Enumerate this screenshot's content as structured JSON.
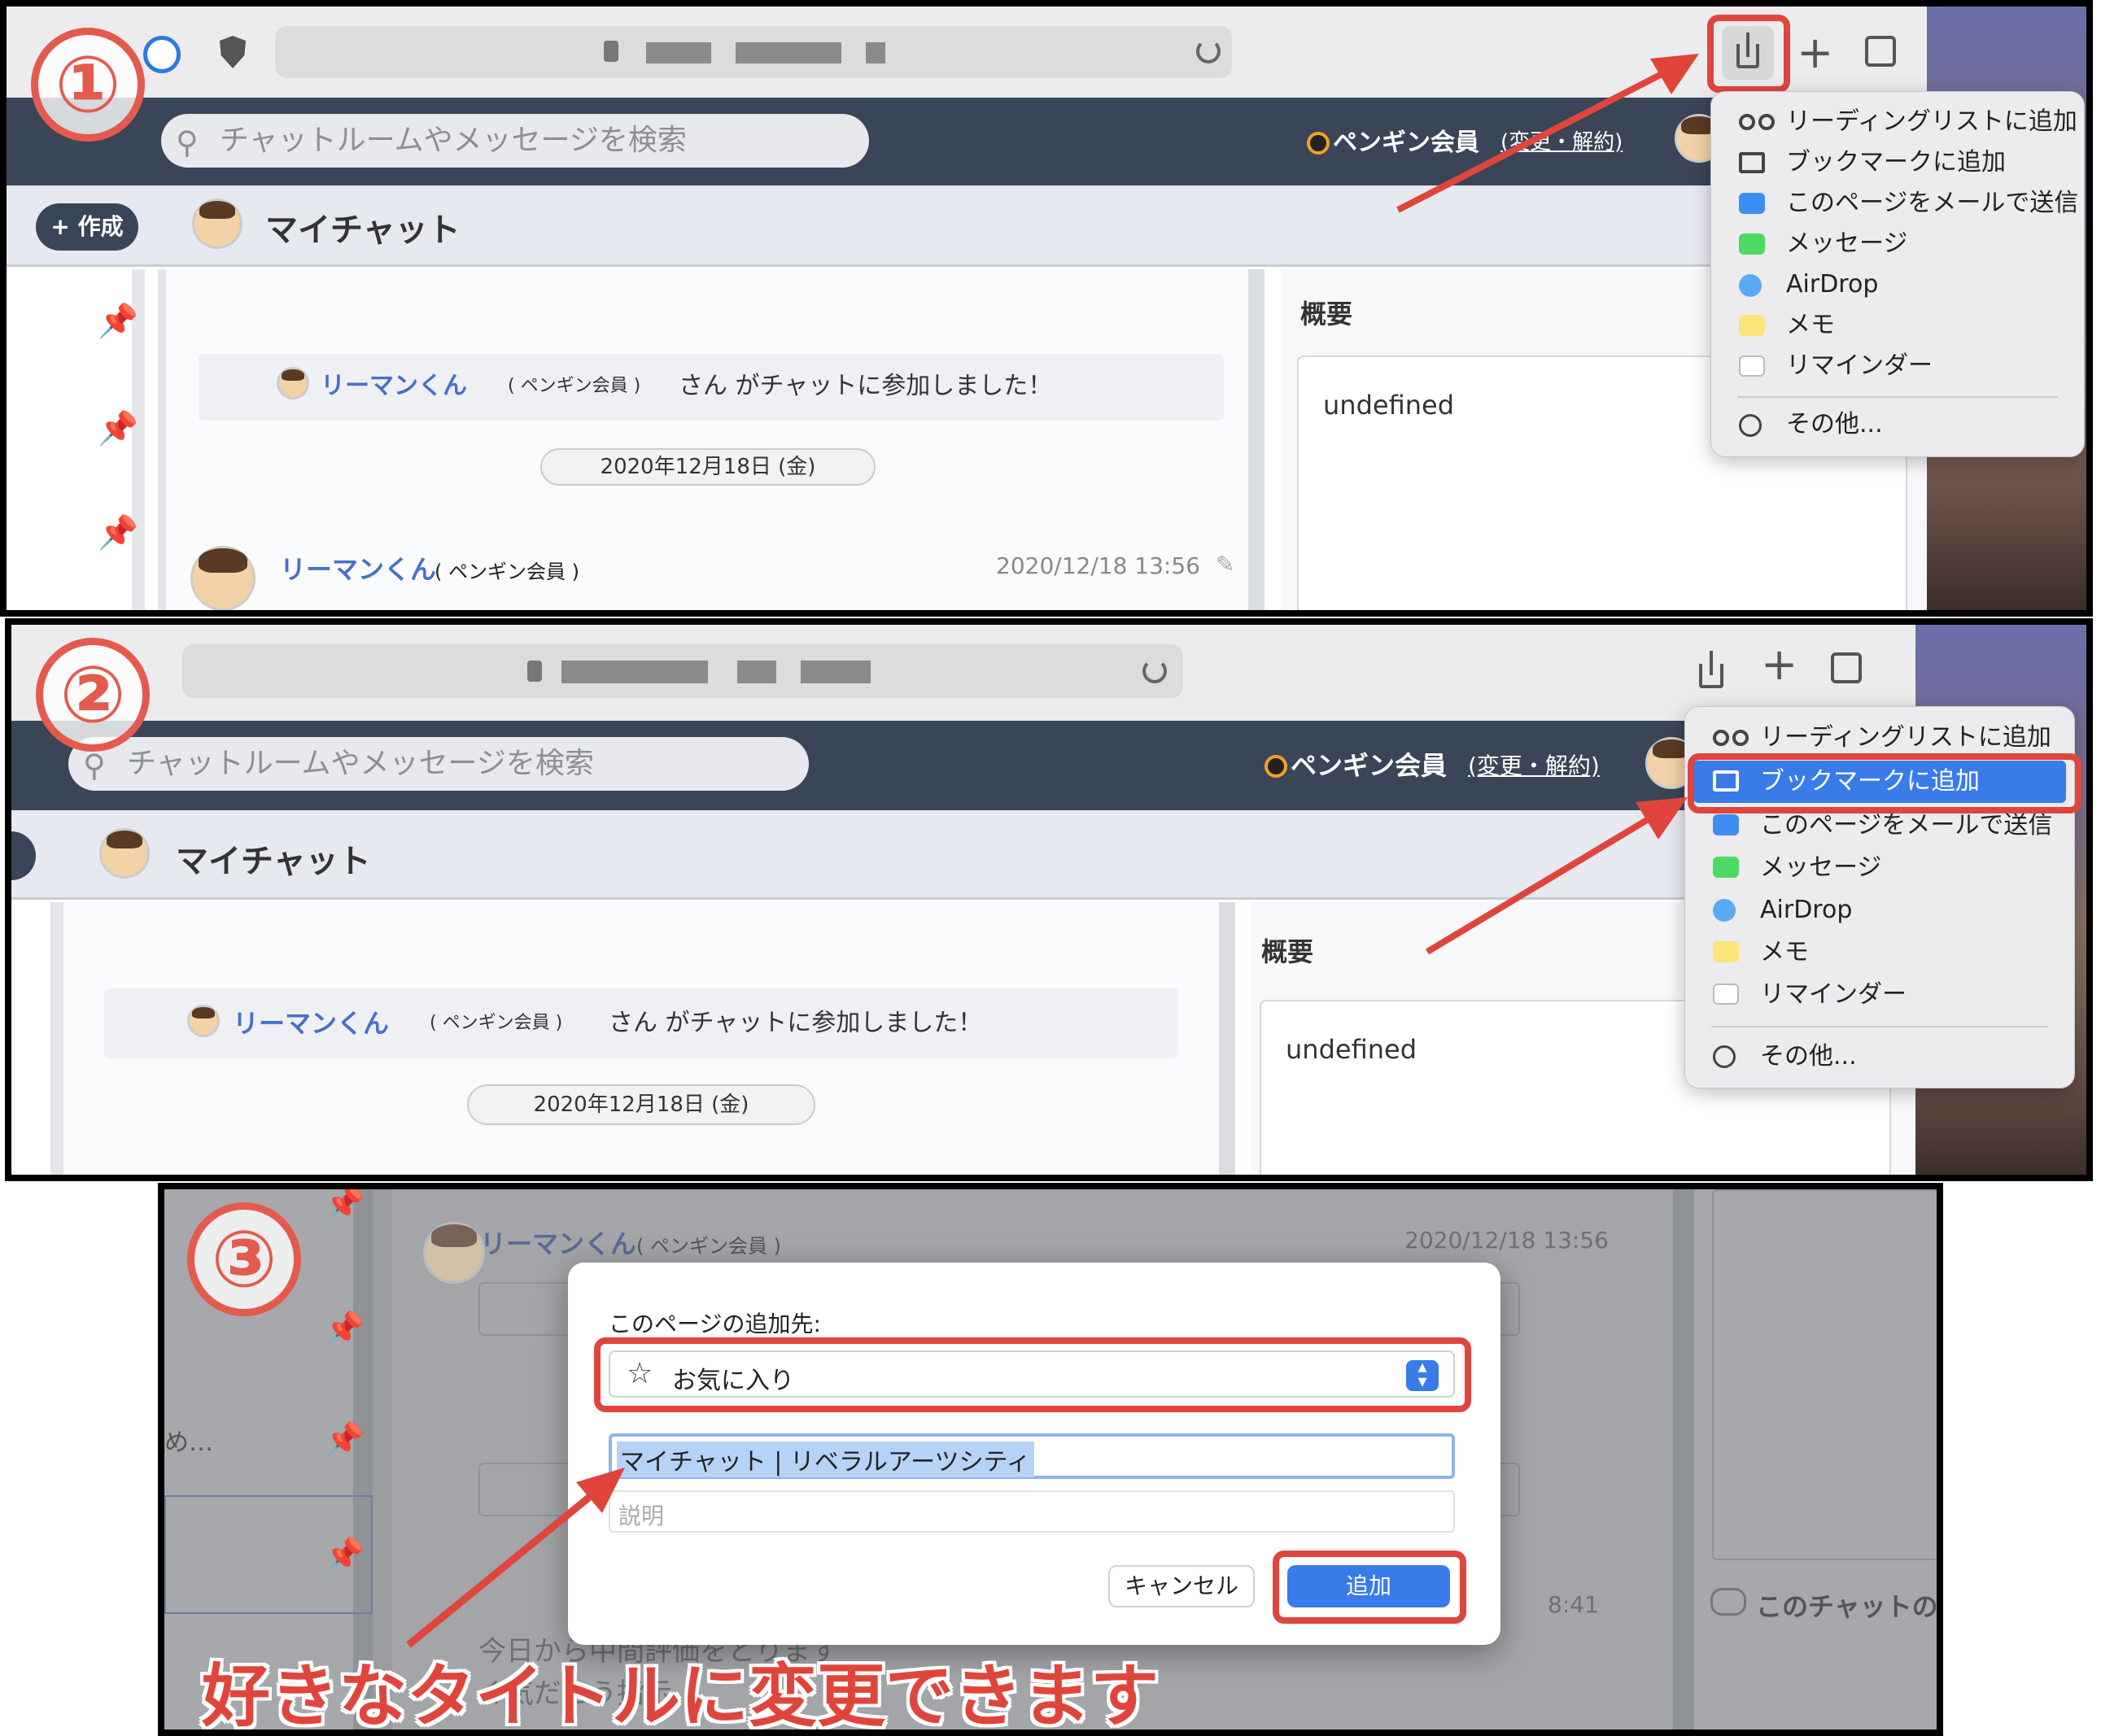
{
  "step_markers": [
    "①",
    "②",
    "③"
  ],
  "browser": {
    "toolbar_icons": [
      "1password-icon",
      "shield-icon",
      "lock-icon",
      "reload-icon",
      "share-icon",
      "new-tab-icon",
      "tabs-overview-icon"
    ]
  },
  "app": {
    "search_placeholder": "チャットルームやメッセージを検索",
    "membership": "ペンギン会員",
    "membership_link": "(変更・解約)",
    "create_button": "作成",
    "page_title": "マイチャット",
    "overview_label": "概要",
    "overview_value": "undefined",
    "system_message": {
      "user": "リーマンくん",
      "member_tag": "( ペンギン会員 )",
      "text": "さん がチャットに参加しました！"
    },
    "date_pill": "2020年12月18日 (金)",
    "message": {
      "user": "リーマンくん",
      "member_tag": "( ペンギン会員 )",
      "timestamp": "2020/12/18 13:56"
    }
  },
  "share_menu": {
    "items": [
      {
        "label": "リーディングリストに追加",
        "icon": "glasses-icon"
      },
      {
        "label": "ブックマークに追加",
        "icon": "book-icon"
      },
      {
        "label": "このページをメールで送信",
        "icon": "mail-icon"
      },
      {
        "label": "メッセージ",
        "icon": "messages-icon"
      },
      {
        "label": "AirDrop",
        "icon": "airdrop-icon"
      },
      {
        "label": "メモ",
        "icon": "notes-icon"
      },
      {
        "label": "リマインダー",
        "icon": "reminders-icon"
      }
    ],
    "more": "その他..."
  },
  "bookmark_dialog": {
    "dest_label": "このページの追加先:",
    "dest_value": "お気に入り",
    "title_value": "マイチャット | リベラルアーツシティ",
    "description_placeholder": "説明",
    "cancel": "キャンセル",
    "add": "追加"
  },
  "background_text": {
    "ellipsis": "め…",
    "time_partial": "8:41",
    "chat_first": "このチャットの最初の",
    "blurred_1": "今日から中間評価をとります",
    "blurred_2": "ぐ気だとう指示"
  },
  "callout": "好きなタイトルに変更できます",
  "colors": {
    "accent_red": "#e0453b",
    "link_blue": "#4a6fc7",
    "header_navy": "#3a4558",
    "mac_blue": "#3a7bea"
  }
}
